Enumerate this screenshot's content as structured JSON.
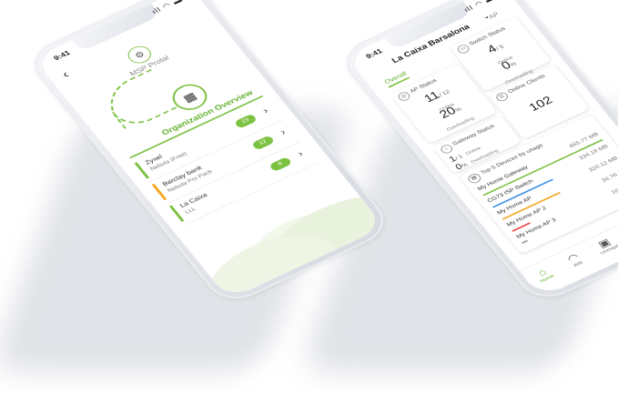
{
  "left_phone": {
    "time": "9:41",
    "status_icons": "ıll ◠ ▬",
    "back_glyph": "‹",
    "msp_label": "MSP Protal",
    "msp_icon": "gear-icon",
    "org_icon": "building-icon",
    "org_title": "Organization Overview",
    "orgs": [
      {
        "name": "Zyxel",
        "sub": "Nebula (Free)",
        "badge": "23",
        "color": "#7cc242"
      },
      {
        "name": "Barclay bank",
        "sub": "Nebula Pro Pack",
        "badge": "12",
        "color": "#f5a623"
      },
      {
        "name": "La Caixa",
        "sub": "LLL",
        "badge": "8",
        "color": "#7cc242"
      }
    ]
  },
  "right_phone": {
    "time": "9:41",
    "status_icons": "ıll ◠ ▬",
    "site_name": "La Caixa Barsalona",
    "site_chevron": "⌄",
    "ap_tab": "AP",
    "overall_tab": "Overall",
    "switch": {
      "title": "Switch Status",
      "online": "4",
      "total": "/ 5",
      "online_label": "Online",
      "overload": "0",
      "unit": "%",
      "overload_label": "Overloading"
    },
    "ap": {
      "title": "AP Status",
      "online": "11",
      "total": "/ 12",
      "online_label": "Online",
      "overload": "20",
      "unit": "%",
      "overload_label": "Overloading"
    },
    "clients": {
      "title": "Online Clients",
      "value": "102"
    },
    "gateway": {
      "title": "Gateway Status",
      "online": "1",
      "total": "/ 1",
      "online_label": "Online",
      "overload": "0",
      "unit": "%",
      "overload_label": "Overloading"
    },
    "top5": {
      "title": "Top 5 Devices by usage",
      "devices": [
        {
          "name": "My Home Gateway",
          "usage": "665.77 MB",
          "color": "#7cc242",
          "fill": 1.0
        },
        {
          "name": "CG73 ISP Switch",
          "usage": "334.19 MB",
          "color": "#3a8ee6",
          "fill": 0.5
        },
        {
          "name": "My Home AP",
          "usage": "320.12 MB",
          "color": "#f5a623",
          "fill": 0.48
        },
        {
          "name": "My Home AP 2",
          "usage": "34.76 MB",
          "color": "#e94b4b",
          "fill": 0.15
        },
        {
          "name": "My Home AP 3",
          "usage": "10.25 MB",
          "color": "#999999",
          "fill": 0.05
        }
      ]
    },
    "fab": "+",
    "tabs": [
      {
        "label": "Home",
        "icon": "⌂",
        "active": true
      },
      {
        "label": "Wifi",
        "icon": "◠",
        "active": false
      },
      {
        "label": "Unmapl",
        "icon": "▣",
        "active": false
      },
      {
        "label": "Org",
        "icon": "▥",
        "active": false
      },
      {
        "label": "Settings",
        "icon": "⚙",
        "active": false
      }
    ]
  }
}
